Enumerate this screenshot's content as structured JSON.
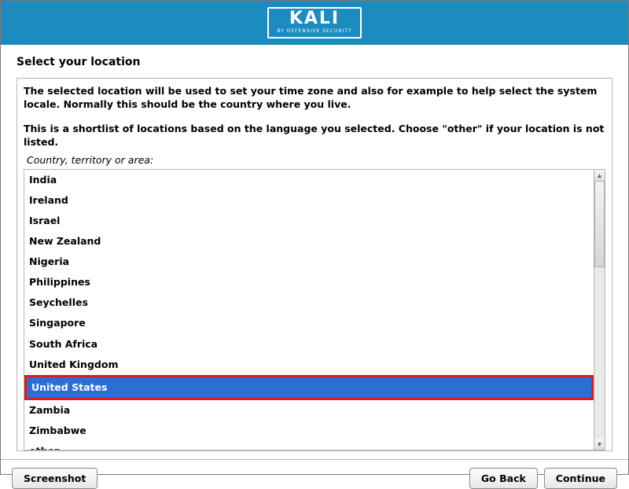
{
  "header": {
    "logo_main": "KALI",
    "logo_sub": "BY OFFENSIVE SECURITY"
  },
  "title": "Select your location",
  "desc1": "The selected location will be used to set your time zone and also for example to help select the system locale. Normally this should be the country where you live.",
  "desc2": "This is a shortlist of locations based on the language you selected. Choose \"other\" if your location is not listed.",
  "prompt": "Country, territory or area:",
  "locations": [
    "India",
    "Ireland",
    "Israel",
    "New Zealand",
    "Nigeria",
    "Philippines",
    "Seychelles",
    "Singapore",
    "South Africa",
    "United Kingdom",
    "United States",
    "Zambia",
    "Zimbabwe",
    "other"
  ],
  "selected_location": "United States",
  "buttons": {
    "screenshot": "Screenshot",
    "goback": "Go Back",
    "continue": "Continue"
  }
}
